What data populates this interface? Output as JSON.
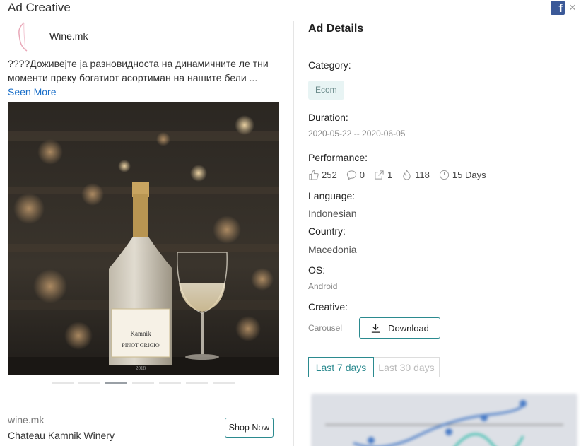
{
  "header": {
    "title": "Ad Creative",
    "facebook_icon": "facebook-icon",
    "close_glyph": "×"
  },
  "ad": {
    "advertiser": "Wine.mk",
    "text": "????Доживејте ја разновидноста на динамичните ле тни моменти преку богатиот асортиман на нашите бели ...",
    "seen_more": "Seen More",
    "carousel_count": 7,
    "active_slide": 3,
    "domain": "wine.mk",
    "page_name": "Chateau Kamnik Winery",
    "cta": "Shop Now",
    "bottle_label": {
      "brand": "Kamnik",
      "variety": "PINOT GRIGIO",
      "year": "2018"
    }
  },
  "details": {
    "title": "Ad Details",
    "category_label": "Category:",
    "category": "Ecom",
    "duration_label": "Duration:",
    "duration": "2020-05-22 -- 2020-06-05",
    "performance_label": "Performance:",
    "performance": {
      "likes": "252",
      "comments": "0",
      "shares": "1",
      "popularity": "118",
      "days": "15 Days"
    },
    "language_label": "Language:",
    "language": "Indonesian",
    "country_label": "Country:",
    "country": "Macedonia",
    "os_label": "OS:",
    "os": "Android",
    "creative_label": "Creative:",
    "creative_type": "Carousel",
    "download": "Download"
  },
  "tabs": {
    "last7": "Last 7 days",
    "last30": "Last 30 days"
  },
  "colors": {
    "accent": "#2b8a8f",
    "link": "#1a6fc9",
    "facebook": "#3b5998"
  }
}
